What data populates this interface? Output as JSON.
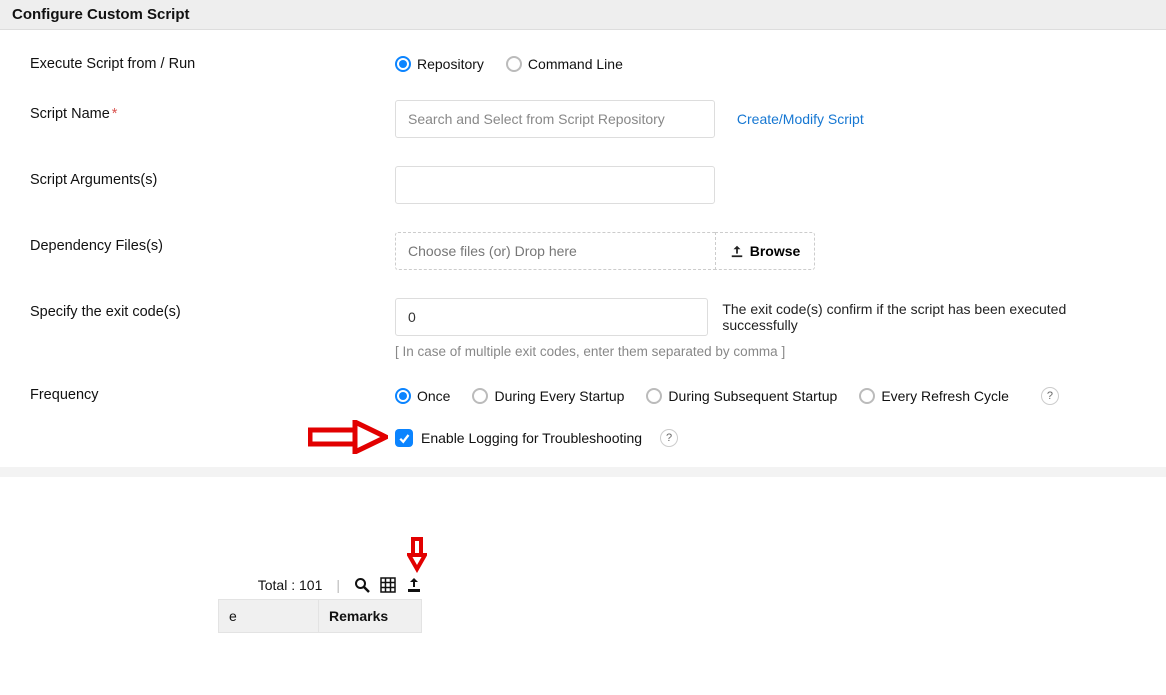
{
  "header": {
    "title": "Configure Custom Script"
  },
  "form": {
    "run_from": {
      "label": "Execute Script from / Run",
      "option_repository": "Repository",
      "option_cmdline": "Command Line"
    },
    "script_name": {
      "label": "Script Name",
      "placeholder": "Search and Select from Script Repository",
      "create_link": "Create/Modify Script"
    },
    "args": {
      "label": "Script Arguments(s)"
    },
    "deps": {
      "label": "Dependency Files(s)",
      "drop_text": "Choose files (or) Drop here",
      "browse": "Browse"
    },
    "exit": {
      "label": "Specify the exit code(s)",
      "value": "0",
      "hint": "The exit code(s) confirm if the script has been executed successfully",
      "sub_hint": "[ In case of multiple exit codes, enter them separated by comma ]"
    },
    "freq": {
      "label": "Frequency",
      "once": "Once",
      "startup": "During Every Startup",
      "subsequent": "During Subsequent Startup",
      "refresh": "Every Refresh Cycle",
      "help": "?"
    },
    "logging": {
      "label": "Enable Logging for Troubleshooting",
      "help": "?"
    }
  },
  "lower": {
    "total_label": "Total : 101",
    "col_e": "e",
    "col_remarks": "Remarks"
  },
  "icons": {
    "search": "search-icon",
    "grid": "grid-icon",
    "export": "export-icon",
    "upload": "upload-icon"
  }
}
